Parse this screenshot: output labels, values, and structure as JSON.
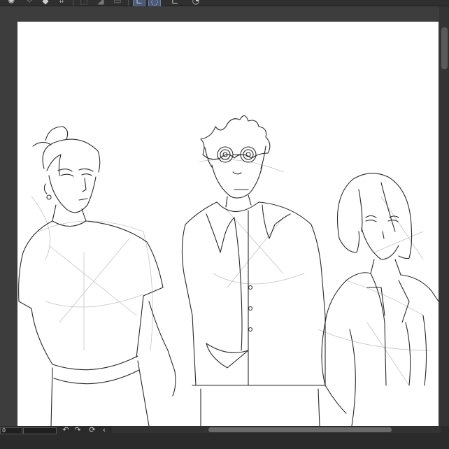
{
  "toolbar": {
    "icons": [
      "burst-icon",
      "sparkle-icon",
      "diamond-icon",
      "frame-icon",
      "selection-icon",
      "fill-icon",
      "layer-icon",
      "lasso-icon",
      "ellipse-select-icon",
      "crop-icon",
      "speech-icon"
    ]
  },
  "canvas": {
    "background": "#ffffff",
    "line_color": "#2a2a2a",
    "sketch_color": "#bdbdbd"
  },
  "bottom": {
    "zoom_value": "0",
    "icons": [
      "undo-icon",
      "redo-icon",
      "rotate-reset-icon",
      "chevron-left-icon"
    ]
  }
}
